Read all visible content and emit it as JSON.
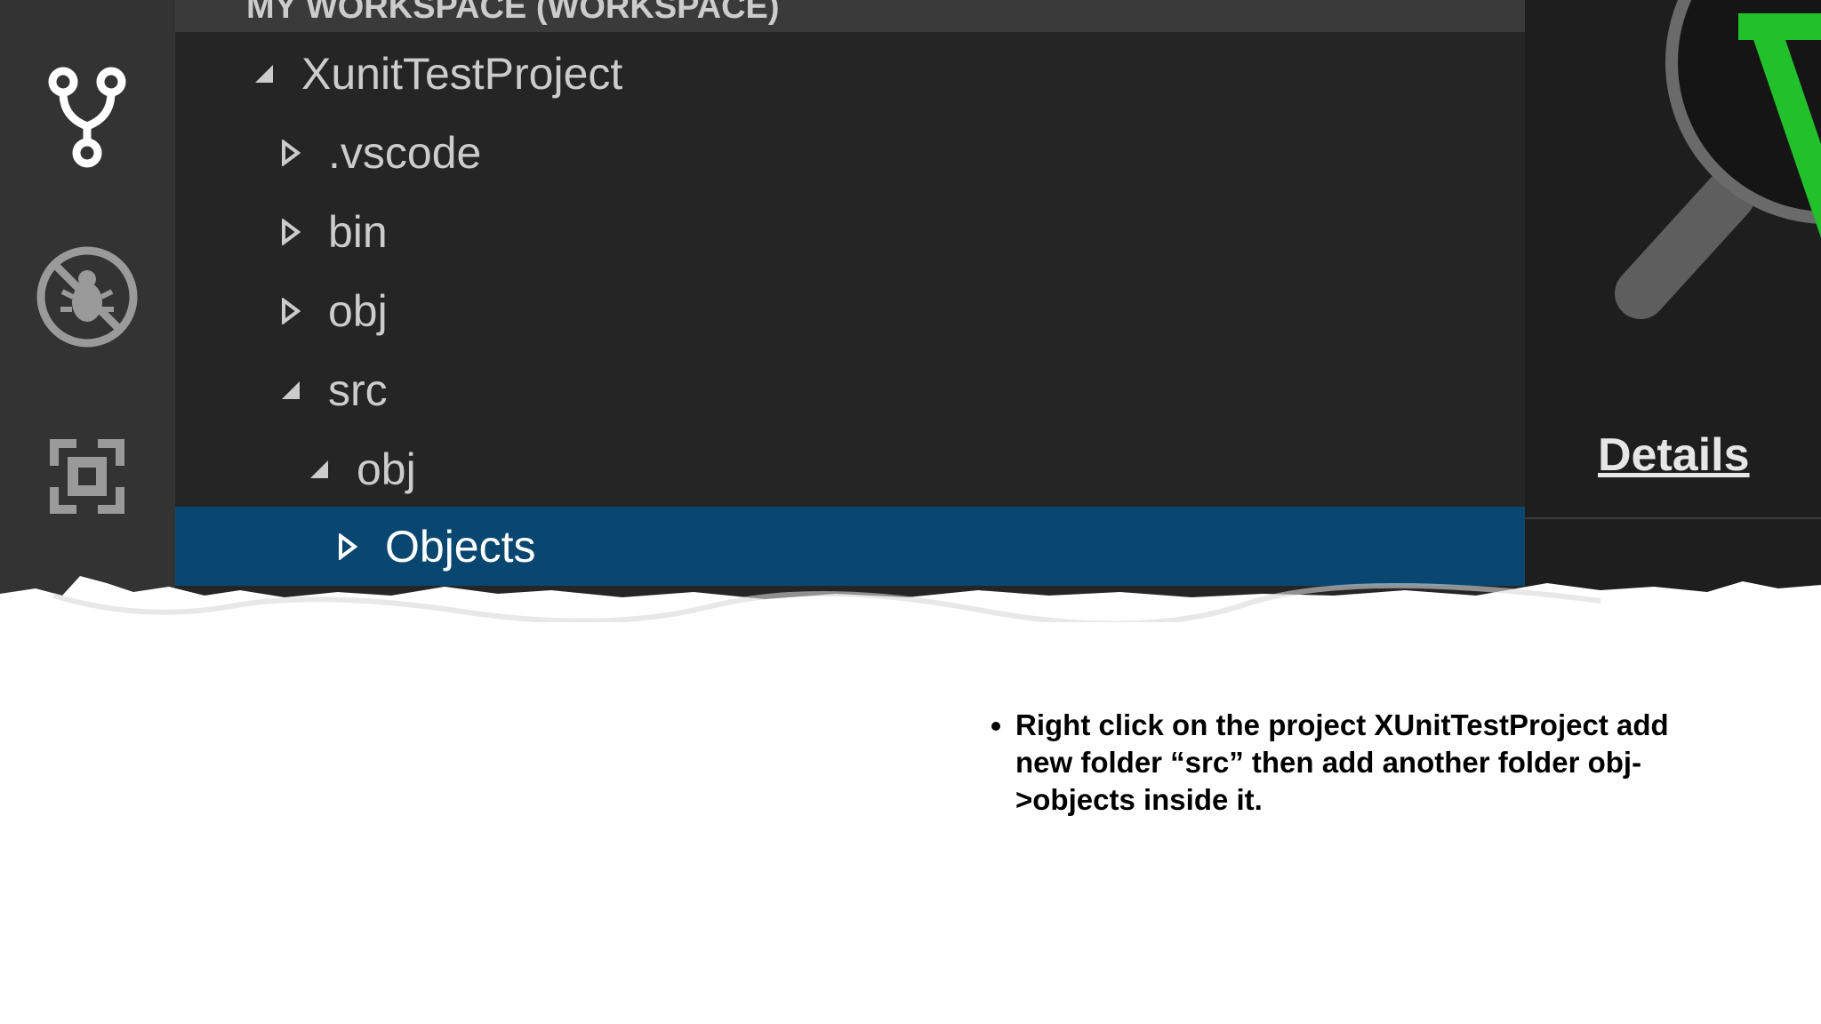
{
  "explorer": {
    "workspace_header": "MY WORKSPACE (WORKSPACE)",
    "tree": [
      {
        "label": "XunitTestProject",
        "state": "expanded",
        "level": 0
      },
      {
        "label": ".vscode",
        "state": "collapsed",
        "level": 1
      },
      {
        "label": "bin",
        "state": "collapsed",
        "level": 1
      },
      {
        "label": "obj",
        "state": "collapsed",
        "level": 1
      },
      {
        "label": "src",
        "state": "expanded",
        "level": 1
      },
      {
        "label": "obj",
        "state": "expanded",
        "level": 2
      },
      {
        "label": "Objects",
        "state": "collapsed",
        "level": 3,
        "selected": true
      }
    ]
  },
  "activity_bar": {
    "icons": [
      "source-control-icon",
      "debug-icon",
      "extensions-icon"
    ]
  },
  "right_panel": {
    "details_label": "Details"
  },
  "caption": {
    "bullet": "Right click on the project XUnitTestProject add new folder “src” then add another folder obj->objects inside it."
  },
  "colors": {
    "sidebar_bg": "#252526",
    "activity_bg": "#333333",
    "selection_bg": "#094771",
    "accent_green": "#22c02a"
  }
}
